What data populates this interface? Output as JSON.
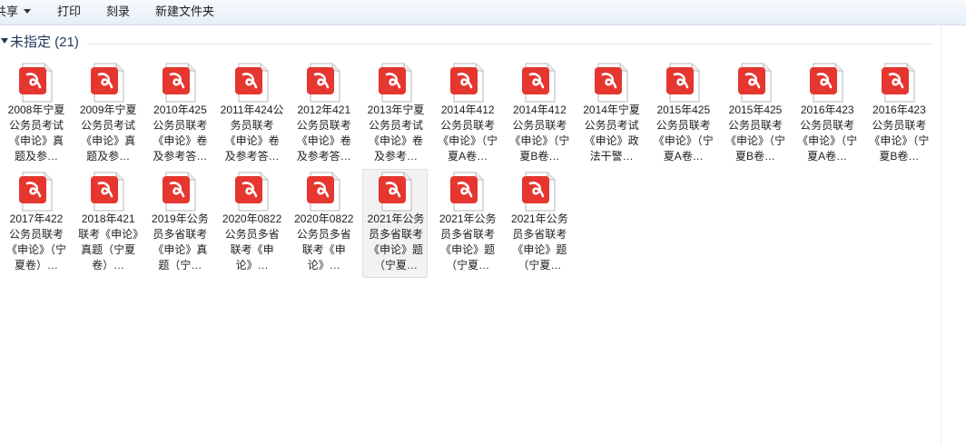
{
  "toolbar": {
    "share_label": "共享",
    "print_label": "打印",
    "burn_label": "刻录",
    "new_folder_label": "新建文件夹"
  },
  "group": {
    "title": "未指定 (21)"
  },
  "icon": {
    "name": "pdf-file-icon",
    "accent": "#e5362f"
  },
  "files": [
    {
      "label": "2008年宁夏公务员考试《申论》真题及参…"
    },
    {
      "label": "2009年宁夏公务员考试《申论》真题及参…"
    },
    {
      "label": "2010年425公务员联考《申论》卷及参考答…"
    },
    {
      "label": "2011年424公务员联考《申论》卷及参考答…"
    },
    {
      "label": "2012年421公务员联考《申论》卷及参考答…"
    },
    {
      "label": "2013年宁夏公务员考试《申论》卷及参考…"
    },
    {
      "label": "2014年412公务员联考《申论》（宁夏A卷…"
    },
    {
      "label": "2014年412公务员联考《申论》（宁夏B卷…"
    },
    {
      "label": "2014年宁夏公务员考试《申论》政法干警…"
    },
    {
      "label": "2015年425公务员联考《申论》（宁夏A卷…"
    },
    {
      "label": "2015年425公务员联考《申论》（宁夏B卷…"
    },
    {
      "label": "2016年423公务员联考《申论》（宁夏A卷…"
    },
    {
      "label": "2016年423公务员联考《申论》（宁夏B卷…"
    },
    {
      "label": "2017年422公务员联考《申论》（宁夏卷）…"
    },
    {
      "label": "2018年421联考《申论》真题（宁夏卷）…"
    },
    {
      "label": "2019年公务员多省联考《申论》真题（宁…"
    },
    {
      "label": "2020年0822公务员多省联考《申论》…"
    },
    {
      "label": "2020年0822公务员多省联考《申论》…"
    },
    {
      "label": "2021年公务员多省联考《申论》题（宁夏…"
    },
    {
      "label": "2021年公务员多省联考《申论》题（宁夏…"
    },
    {
      "label": "2021年公务员多省联考《申论》题（宁夏…"
    }
  ]
}
